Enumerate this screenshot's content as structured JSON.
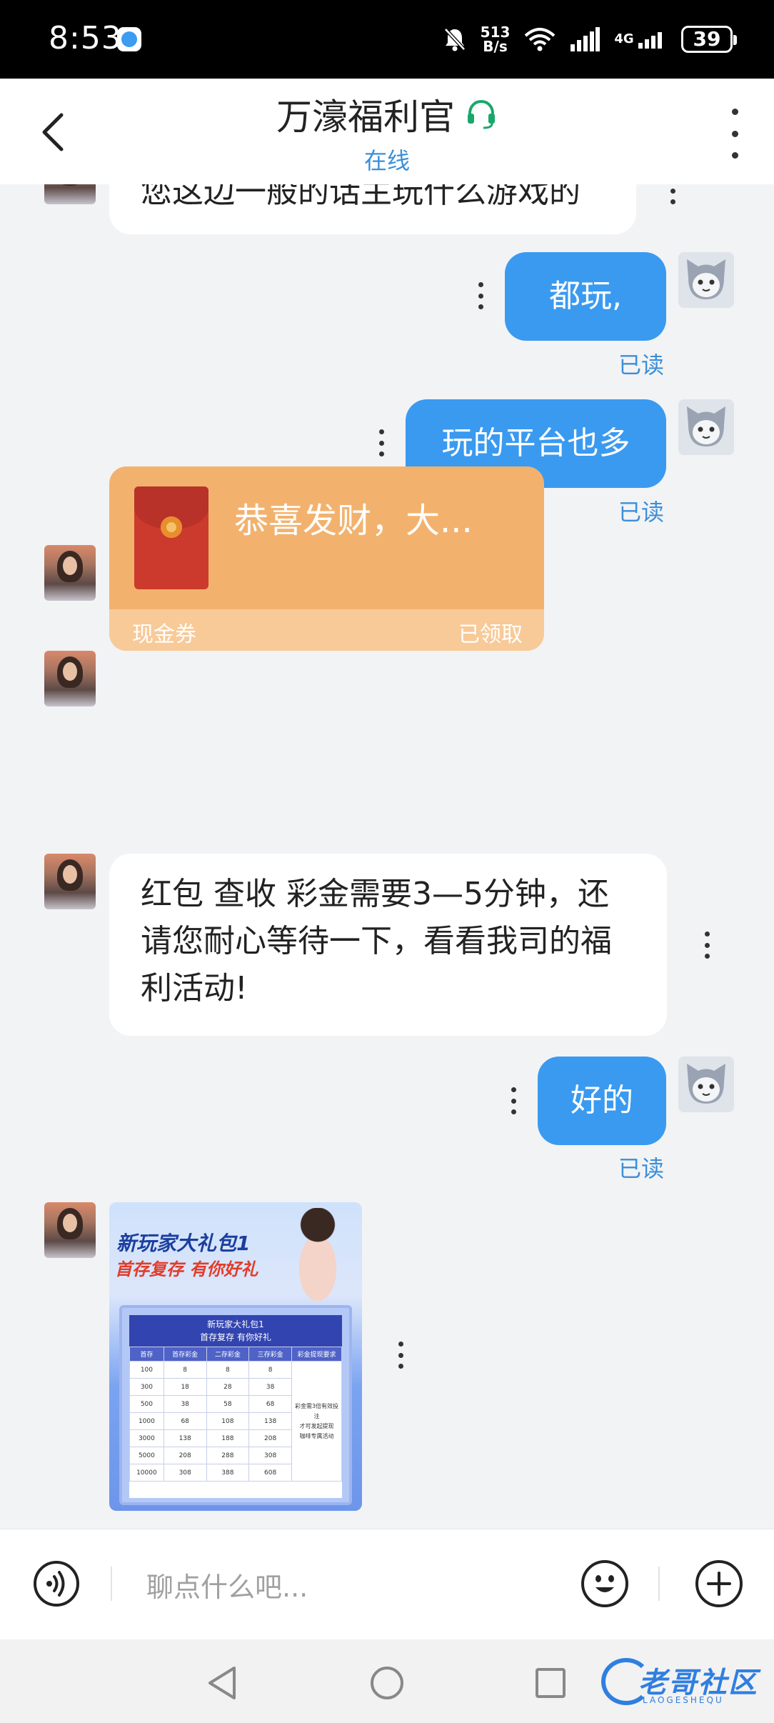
{
  "status_bar": {
    "time": "8:53",
    "net_speed_value": "513",
    "net_speed_unit": "B/s",
    "network": "4G",
    "battery": "39",
    "icons": [
      "app-notification-icon",
      "bell-muted-icon",
      "wifi-icon",
      "signal-icon",
      "battery-icon"
    ]
  },
  "header": {
    "title": "万濠福利官",
    "status": "在线",
    "icons": [
      "back-arrow-icon",
      "headset-icon",
      "more-vertical-icon"
    ]
  },
  "messages": {
    "m0": "您这边一般的话主玩什么游戏的",
    "m1": "都玩,",
    "m1_read": "已读",
    "m2": "玩的平台也多",
    "m2_read": "已读",
    "m3": "好的",
    "m5": "红包 查收 彩金需要3—5分钟，还请您耐心等待一下，看看我司的福利活动!",
    "m6": "好的",
    "m6_read": "已读"
  },
  "red_packet": {
    "title": "恭喜发财，大...",
    "label": "现金券",
    "status": "已领取"
  },
  "promo_image": {
    "headline": "新玩家大礼包1",
    "subheadline": "首存复存 有你好礼",
    "table_title": "新玩家大礼包1",
    "table_subtitle": "首存复存 有你好礼",
    "columns": [
      "首存",
      "首存彩金",
      "二存彩金",
      "三存彩金",
      "彩金提现要求"
    ],
    "rows": [
      [
        "100",
        "8",
        "8",
        "8"
      ],
      [
        "300",
        "18",
        "28",
        "38"
      ],
      [
        "500",
        "38",
        "58",
        "68"
      ],
      [
        "1000",
        "68",
        "108",
        "138"
      ],
      [
        "3000",
        "138",
        "188",
        "208"
      ],
      [
        "5000",
        "208",
        "288",
        "308"
      ],
      [
        "10000",
        "308",
        "388",
        "608"
      ]
    ],
    "note_1": "彩金需3倍有效投注",
    "note_2": "才可发起提现",
    "note_3": "咖啡专属活动"
  },
  "input_bar": {
    "placeholder": "聊点什么吧...",
    "icons": [
      "voice-icon",
      "emoji-icon",
      "plus-icon"
    ]
  },
  "navigation": {
    "icons": [
      "nav-back-icon",
      "nav-home-icon",
      "nav-recent-icon"
    ]
  },
  "watermark": {
    "text": "老哥社区",
    "sub": "LAOGESHEQU"
  },
  "colors": {
    "accent_blue": "#3a9af0",
    "read_blue": "#3b8fd8",
    "packet_orange": "#f2b26e",
    "online_green": "#19a86b"
  }
}
